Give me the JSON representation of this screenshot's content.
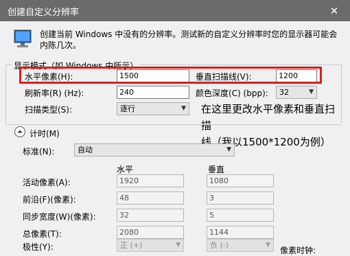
{
  "window": {
    "title": "创建自定义分辨率",
    "close_symbol": "✕"
  },
  "intro": {
    "line1": "创建当前 Windows 中没有的分辨率。测试新的自定义分辨率时您的显示器可能会",
    "line2": "内陈几次。"
  },
  "display_mode": {
    "group_label": "显示模式（如 Windows 中所示）",
    "h_pixels": {
      "label": "水平像素(H):",
      "value": "1500"
    },
    "v_lines": {
      "label": "垂直扫描线(V):",
      "value": "1200"
    },
    "refresh": {
      "label": "刷新率(R) (Hz):",
      "value": "240"
    },
    "color_depth": {
      "label": "颜色深度(C) (bpp):",
      "value": "32"
    },
    "scan_type": {
      "label": "扫描类型(S):",
      "value": "逐行"
    }
  },
  "annotation": {
    "line1": "在这里更改水平像素和垂直扫描",
    "line2": "线（我以1500*1200为例）",
    "color": "#d91e1e"
  },
  "timing": {
    "toggle_label": "计时(M)",
    "standard": {
      "label": "标准(N):",
      "value": "自动"
    },
    "col_h": "水平",
    "col_v": "垂直",
    "rows": [
      {
        "label": "活动像素(A):",
        "h": "1920",
        "v": "1080"
      },
      {
        "label": "前沿(F)(像素):",
        "h": "48",
        "v": "3"
      },
      {
        "label": "同步宽度(W)(像素):",
        "h": "32",
        "v": "5"
      },
      {
        "label": "总像素(T):",
        "h": "2080",
        "v": "1144"
      }
    ],
    "polarity": {
      "label": "极性(Y):",
      "h": "正 (+)",
      "v": "负 (-)"
    },
    "pixel_clock_label": "像素时钟:"
  }
}
